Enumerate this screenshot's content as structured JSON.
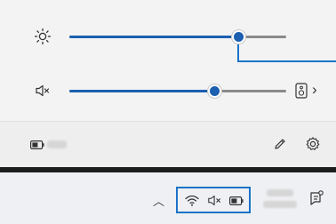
{
  "quick_settings": {
    "brightness": {
      "icon": "brightness-icon",
      "level": 0.78
    },
    "volume": {
      "icon": "speaker-muted-icon",
      "level": 0.67,
      "output_icon": "speaker-device-icon",
      "output_chevron": "›"
    },
    "footer": {
      "battery_icon": "battery-icon",
      "edit_icon": "pencil-icon",
      "settings_icon": "gear-icon"
    }
  },
  "taskbar": {
    "overflow_chevron": "︿",
    "tray_icons": [
      "wifi-icon",
      "speaker-muted-icon",
      "battery-icon"
    ],
    "notification_icon": "notification-icon"
  },
  "colors": {
    "accent": "#1a5fb0",
    "callout": "#1a73c9",
    "taskbar_divider": "#1c1c1c"
  }
}
